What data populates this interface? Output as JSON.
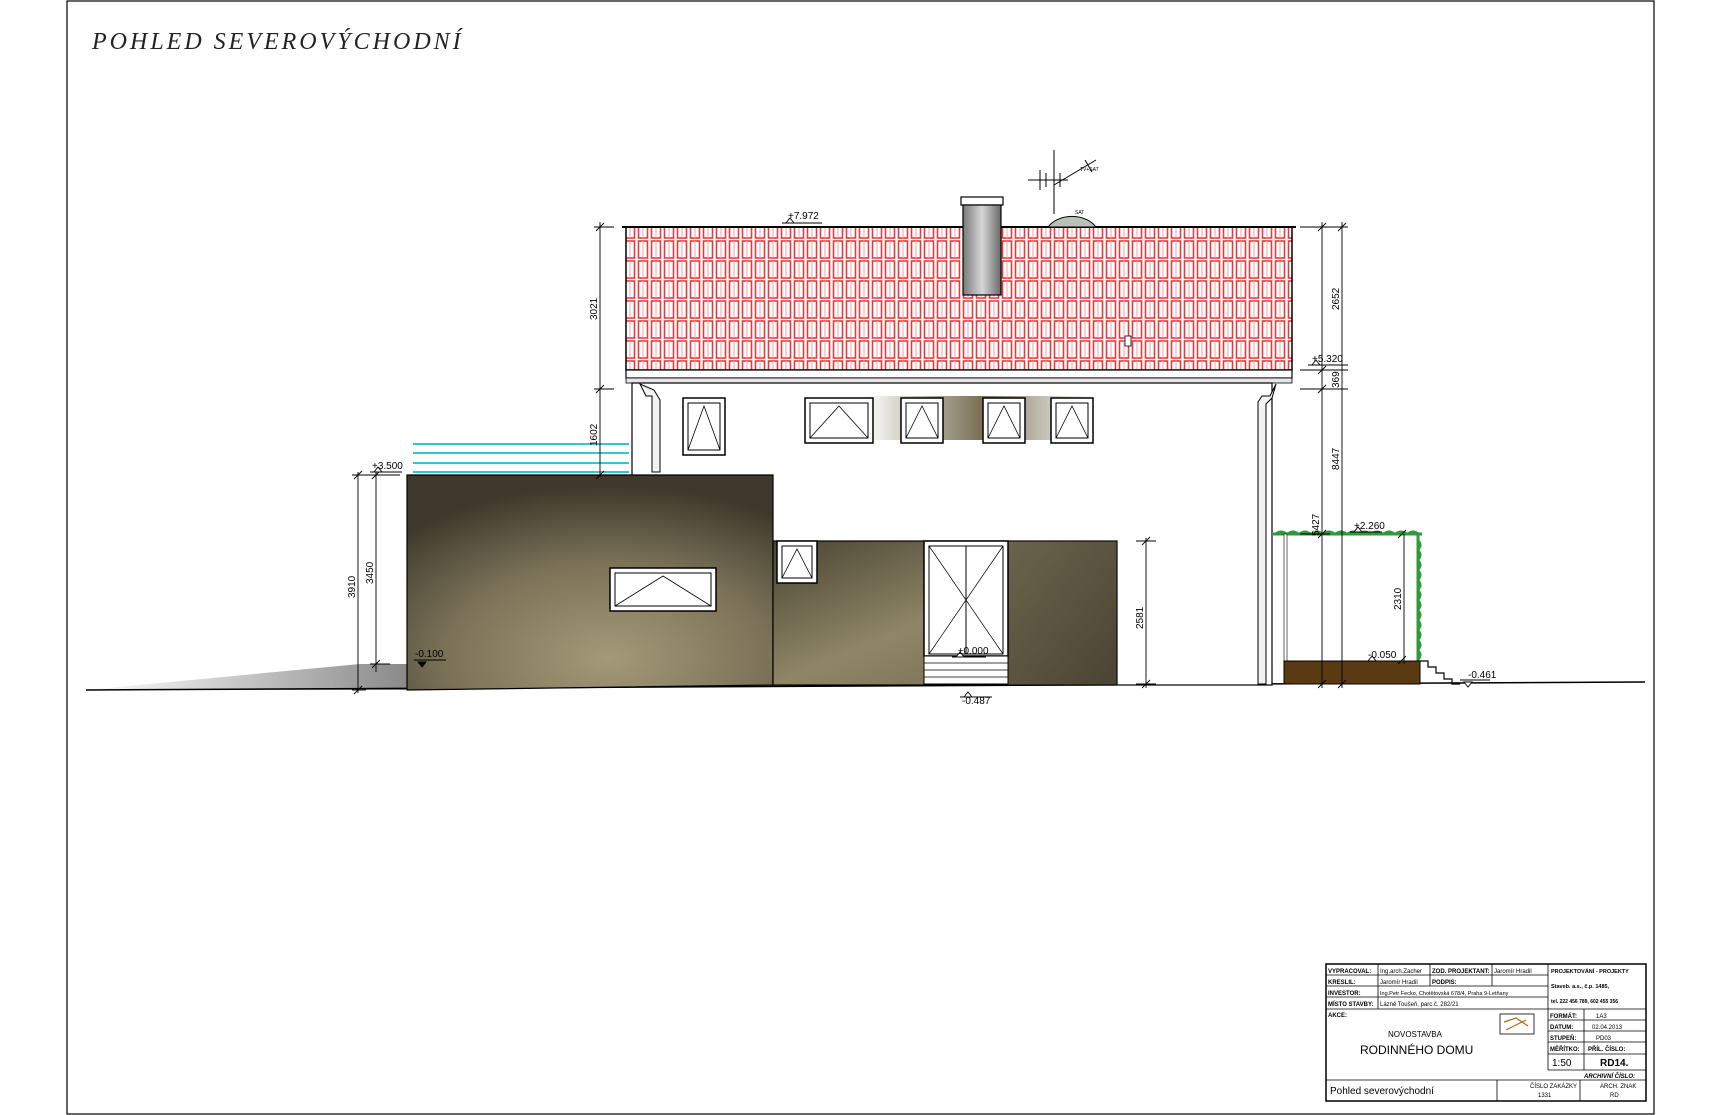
{
  "drawing": {
    "title": "POHLED SEVEROVÝCHODNÍ"
  },
  "levels": {
    "ridge": "+7.972",
    "eaves": "+5.320",
    "terrace_roof": "+3.500",
    "garden_floor": "-0.100",
    "entrance": "±0.000",
    "terrain_door": "-0.487",
    "pergola": "+2.260",
    "pergola_floor": "-0.050",
    "terrain_right": "-0.461"
  },
  "dimensions": {
    "roof_height": "3021",
    "wall_upper": "1602",
    "left_total": "3910",
    "left_wall": "3450",
    "door_wall": "2581",
    "right_roof": "2652",
    "right_369": "369",
    "right_total": "8447",
    "right_5427": "5427",
    "pergola_height": "2310"
  },
  "annotations": {
    "antenna": "TV+SAT",
    "dish": "SAT"
  },
  "colors": {
    "tile_red": "#e23b3b",
    "wall_dark": "#4a4433",
    "wall_light": "#a09674",
    "railing": "#33c6d6",
    "pergola_green": "#2f9a3a",
    "deck_brown": "#5a3a12"
  },
  "titleblock": {
    "r1_label": "VYPRACOVAL:",
    "r1_value": "Ing.arch.Zacher",
    "r1_label2": "ZOD. PROJEKTANT:",
    "r1_value2": "Jaromír Hradil",
    "r2_label": "KRESLIL:",
    "r2_value": "Jaromír Hradil",
    "r2_label2": "PODPIS:",
    "r3_label": "INVESTOR:",
    "r3_value": "Ing.Petr Fecko, Chotětovská 678/4, Praha 9-Letňany",
    "r4_label": "MÍSTO STAVBY:",
    "r4_value": "Lázně Toušeň, parc.č. 282/21",
    "company1": "PROJEKTOVÁNÍ - PROJEKTY",
    "company2": "Staveb. a.s., č.p. 1485,",
    "company3": "tel. 222 456 789, 602 455 356",
    "akce_label": "AKCE:",
    "project1": "NOVOSTAVBA",
    "project2": "RODINNÉHO DOMU",
    "format_label": "FORMÁT:",
    "format_value": "1A3",
    "datum_label": "DATUM:",
    "datum_value": "02.04.2013",
    "stupen_label": "STUPEŇ:",
    "stupen_value": "PD03",
    "merito_label": "MĚŘÍTKO:",
    "merito_value": "1:50",
    "priloha_label": "PŘÍL. ČÍSLO:",
    "priloha_value": "RD14.",
    "cisla_label": "ARCHIVNÍ ČÍSLO:",
    "drawing_name": "Pohled severovýchodní",
    "zakazka_label": "ČÍSLO ZAKÁZKY",
    "zakazka_value": "1331",
    "arch_label": "ARCH. ZNAK",
    "arch_value": "RD"
  }
}
